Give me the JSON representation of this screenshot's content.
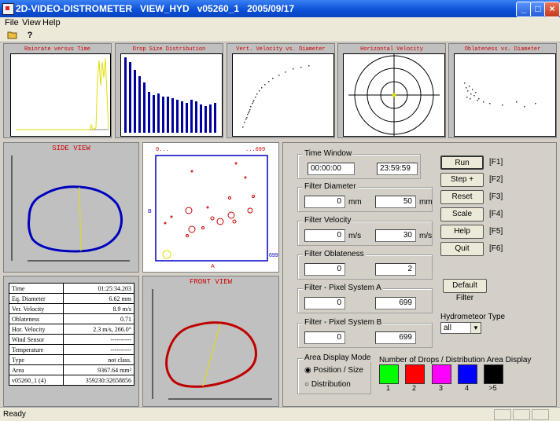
{
  "window": {
    "title": "2D-VIDEO-DISTROMETER   VIEW_HYD   v05260_1   2005/09/17"
  },
  "menu": [
    "File",
    "View",
    "Help"
  ],
  "toolbar": {
    "open_icon": "folder-open-icon",
    "help_icon": "context-help-icon"
  },
  "graphs": {
    "rainrate": "Rainrate versus Time",
    "dsd": "Drop Size Distribution",
    "vv": "Vert. Velocity vs. Diameter",
    "hv": "Horizontal Velocity",
    "ob": "Oblateness vs. Diameter"
  },
  "views": {
    "side": "SIDE VIEW",
    "front": "FRONT VIEW",
    "pixel_top_left": "0...",
    "pixel_top_right": "...699",
    "axis_a": "A",
    "axis_b": "B",
    "b_max": "699"
  },
  "info": [
    {
      "label": "Time",
      "value": "01:25:34.203"
    },
    {
      "label": "Eq. Diameter",
      "value": "6.62 mm"
    },
    {
      "label": "Ver. Velocity",
      "value": "8.9 m/s"
    },
    {
      "label": "Oblateness",
      "value": "0.71"
    },
    {
      "label": "Hor. Velocity",
      "value": "2.3 m/s, 266.0°"
    },
    {
      "label": "Wind Sensor",
      "value": "----------"
    },
    {
      "label": "Temperature",
      "value": "----------"
    },
    {
      "label": "Type",
      "value": "not class."
    },
    {
      "label": "Area",
      "value": "9367.64 mm²"
    },
    {
      "label": "v05260_1 (4)",
      "value": "359230:32658856"
    }
  ],
  "controls": {
    "time_window": {
      "label": "Time Window",
      "start": "00:00:00",
      "end": "23:59:59"
    },
    "filter_diameter": {
      "label": "Filter Diameter",
      "min": "0",
      "max": "50",
      "unit": "mm"
    },
    "filter_velocity": {
      "label": "Filter Velocity",
      "min": "0",
      "max": "30",
      "unit": "m/s"
    },
    "filter_oblateness": {
      "label": "Filter Oblateness",
      "min": "0",
      "max": "2"
    },
    "filter_psa": {
      "label": "Filter - Pixel System A",
      "min": "0",
      "max": "699"
    },
    "filter_psb": {
      "label": "Filter - Pixel System B",
      "min": "0",
      "max": "699"
    },
    "area_mode": {
      "label": "Area Display Mode",
      "opt1": "Position / Size",
      "opt2": "Distribution"
    },
    "drops_label": "Number of Drops / Distribution Area Display",
    "swatches": [
      {
        "label": "1",
        "color": "#00ff00"
      },
      {
        "label": "2",
        "color": "#ff0000"
      },
      {
        "label": "3",
        "color": "#ff00ff"
      },
      {
        "label": "4",
        "color": "#0000ff"
      },
      {
        "label": ">5",
        "color": "#000000"
      }
    ],
    "hydrometeor": {
      "label": "Hydrometeor Type",
      "value": "all"
    },
    "default_filter": "Default Filter"
  },
  "buttons": [
    {
      "label": "Run",
      "key": "[F1]"
    },
    {
      "label": "Step +",
      "key": "[F2]"
    },
    {
      "label": "Reset",
      "key": "[F3]"
    },
    {
      "label": "Scale",
      "key": "[F4]"
    },
    {
      "label": "Help",
      "key": "[F5]"
    },
    {
      "label": "Quit",
      "key": "[F6]"
    }
  ],
  "status": "Ready"
}
